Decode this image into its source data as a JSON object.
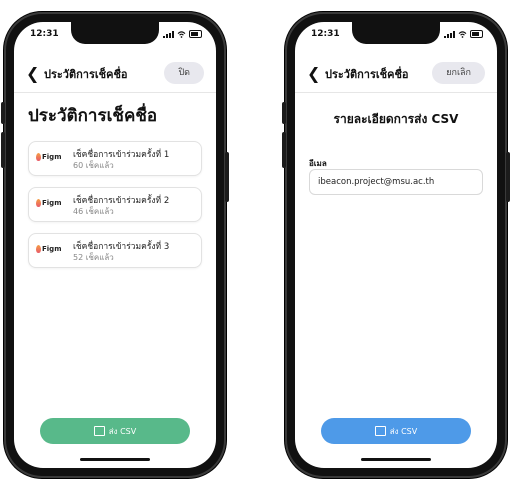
{
  "status": {
    "time": "12:31"
  },
  "history_screen": {
    "back_label": "ประวัติการเช็คชื่อ",
    "close_label": "ปิด",
    "page_title": "ประวัติการเช็คชื่อ",
    "items": [
      {
        "logo": "Figm",
        "title": "เช็คชื่อการเข้าร่วมครั้งที่ 1",
        "count": "60 เช็คแล้ว"
      },
      {
        "logo": "Figm",
        "title": "เช็คชื่อการเข้าร่วมครั้งที่ 2",
        "count": "46 เช็คแล้ว"
      },
      {
        "logo": "Figm",
        "title": "เช็คชื่อการเข้าร่วมครั้งที่ 3",
        "count": "52 เช็คแล้ว"
      }
    ],
    "send_csv_label": "ส่ง CSV",
    "button_color": "#58b98a"
  },
  "detail_screen": {
    "back_label": "ประวัติการเช็คชื่อ",
    "cancel_label": "ยกเลิก",
    "title": "รายละเอียดการส่ง CSV",
    "email_label": "อีเมล",
    "email_value": "ibeacon.project@msu.ac.th",
    "send_csv_label": "ส่ง CSV",
    "button_color": "#4e9ae8"
  }
}
